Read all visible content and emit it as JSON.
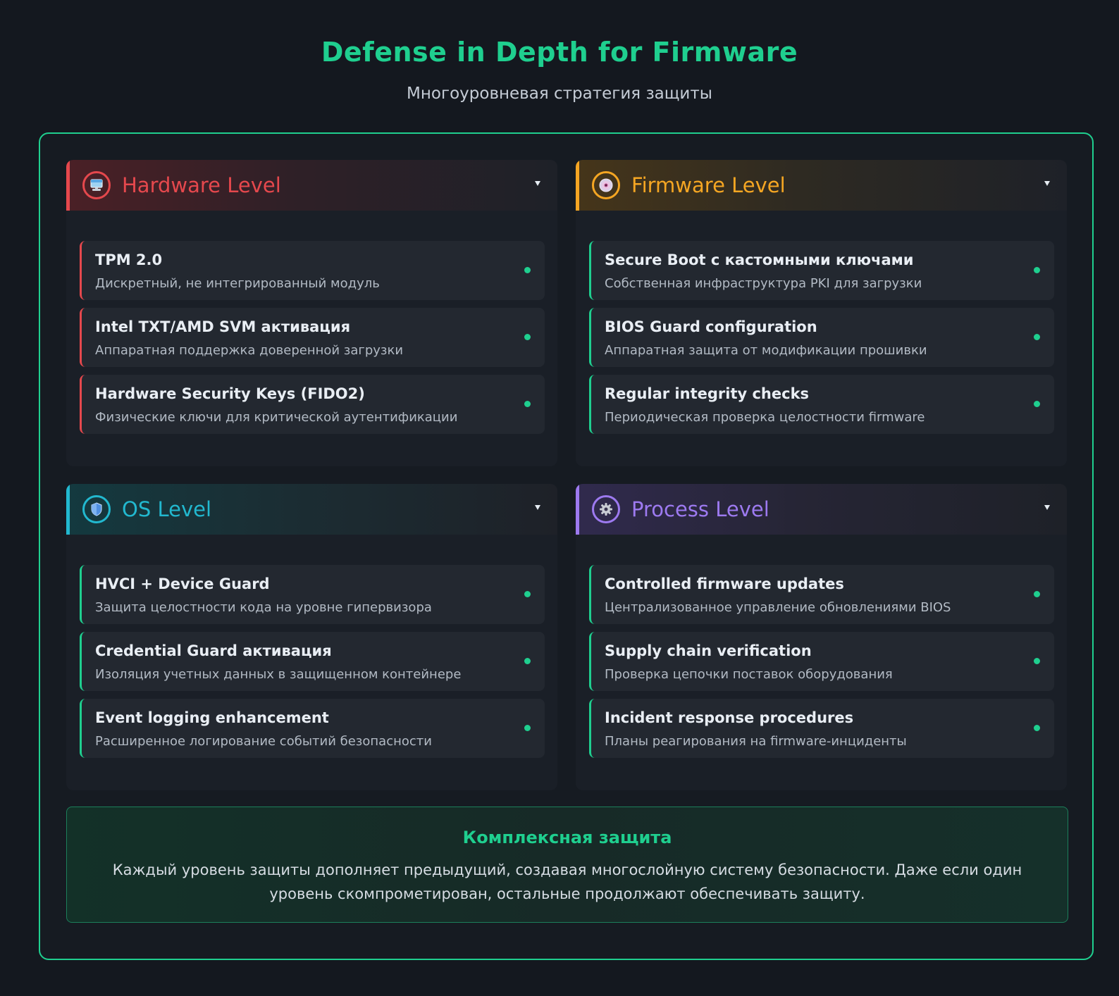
{
  "title": "Defense in Depth for Firmware",
  "subtitle": "Многоуровневая стратегия защиты",
  "colors": {
    "accent": "#1fcf8f",
    "hardware": "#e5484d",
    "firmware": "#f5a623",
    "os": "#22b8cf",
    "process": "#9d7af0"
  },
  "levels": [
    {
      "title": "Hardware Level",
      "icon": "computer-icon",
      "items": [
        {
          "title": "TPM 2.0",
          "desc": "Дискретный, не интегрированный модуль"
        },
        {
          "title": "Intel TXT/AMD SVM активация",
          "desc": "Аппаратная поддержка доверенной загрузки"
        },
        {
          "title": "Hardware Security Keys (FIDO2)",
          "desc": "Физические ключи для критической аутентификации"
        }
      ]
    },
    {
      "title": "Firmware Level",
      "icon": "disc-icon",
      "items": [
        {
          "title": "Secure Boot с кастомными ключами",
          "desc": "Собственная инфраструктура PKI для загрузки"
        },
        {
          "title": "BIOS Guard configuration",
          "desc": "Аппаратная защита от модификации прошивки"
        },
        {
          "title": "Regular integrity checks",
          "desc": "Периодическая проверка целостности firmware"
        }
      ]
    },
    {
      "title": "OS Level",
      "icon": "shield-icon",
      "items": [
        {
          "title": "HVCI + Device Guard",
          "desc": "Защита целостности кода на уровне гипервизора"
        },
        {
          "title": "Credential Guard активация",
          "desc": "Изоляция учетных данных в защищенном контейнере"
        },
        {
          "title": "Event logging enhancement",
          "desc": "Расширенное логирование событий безопасности"
        }
      ]
    },
    {
      "title": "Process Level",
      "icon": "gear-icon",
      "items": [
        {
          "title": "Controlled firmware updates",
          "desc": "Централизованное управление обновлениями BIOS"
        },
        {
          "title": "Supply chain verification",
          "desc": "Проверка цепочки поставок оборудования"
        },
        {
          "title": "Incident response procedures",
          "desc": "Планы реагирования на firmware-инциденты"
        }
      ]
    }
  ],
  "summary": {
    "title": "Комплексная защита",
    "text": "Каждый уровень защиты дополняет предыдущий, создавая многослойную систему безопасности. Даже если один уровень скомпрометирован, остальные продолжают обеспечивать защиту."
  }
}
